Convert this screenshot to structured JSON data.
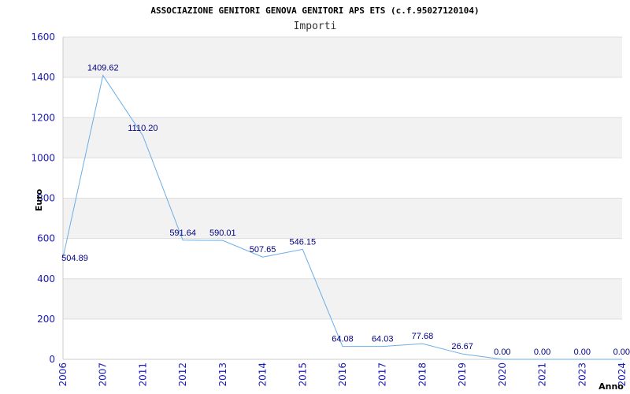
{
  "chart_data": {
    "type": "line",
    "title": "ASSOCIAZIONE GENITORI GENOVA GENITORI APS ETS (c.f.95027120104)",
    "subtitle": "Importi",
    "xlabel": "Anno",
    "ylabel": "Euro",
    "categories": [
      "2006",
      "2007",
      "2011",
      "2012",
      "2013",
      "2014",
      "2015",
      "2016",
      "2017",
      "2018",
      "2019",
      "2020",
      "2021",
      "2023",
      "2024"
    ],
    "series": [
      {
        "values": [
          504.89,
          1409.62,
          1110.2,
          591.64,
          590.01,
          507.65,
          546.15,
          64.08,
          64.03,
          77.68,
          26.67,
          0.0,
          0.0,
          0.0,
          0.0
        ]
      }
    ],
    "data_labels": [
      "504.89",
      "1409.62",
      "1110.20",
      "591.64",
      "590.01",
      "507.65",
      "546.15",
      "64.08",
      "64.03",
      "77.68",
      "26.67",
      "0.00",
      "0.00",
      "0.00",
      "0.00"
    ],
    "ylim": [
      0,
      1600
    ],
    "yticks": [
      0,
      200,
      400,
      600,
      800,
      1000,
      1200,
      1400,
      1600
    ],
    "grid": true,
    "line_color": "#6aaee6",
    "band_color": "#f2f2f2",
    "tick_color": "#1a1ab5",
    "label_color": "#000080"
  }
}
